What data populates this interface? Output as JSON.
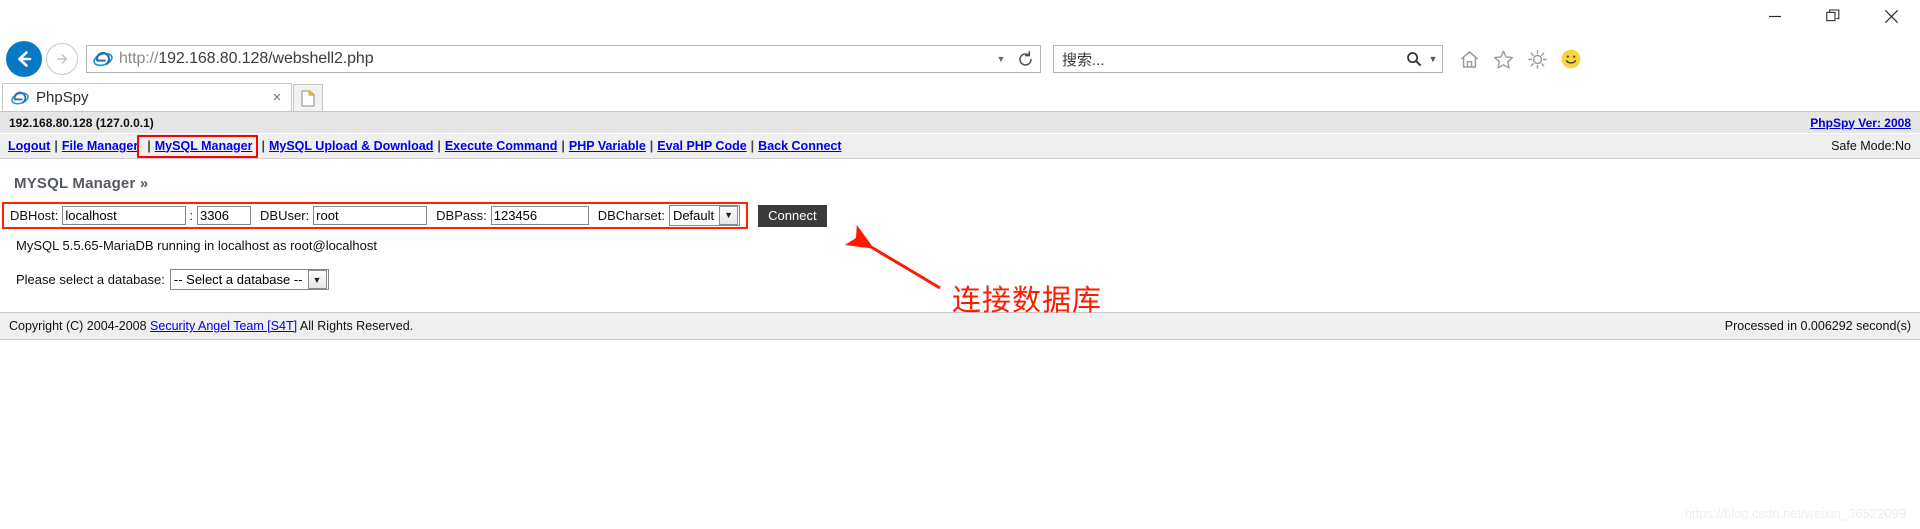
{
  "browser": {
    "window_controls": {
      "minimize": "minimize-icon",
      "restore": "restore-icon",
      "close": "close-icon"
    },
    "back_icon": "back-arrow-icon",
    "forward_icon": "forward-arrow-icon",
    "url_scheme": "http://",
    "url_rest": "192.168.80.128/webshell2.php",
    "url_full": "http://192.168.80.128/webshell2.php",
    "refresh_icon": "refresh-icon",
    "address_dropdown_icon": "chevron-down-icon",
    "search_placeholder": "搜索...",
    "search_icon": "search-magnifier-icon",
    "search_dropdown_icon": "chevron-down-icon",
    "toolbar_icons": [
      "home-icon",
      "favorites-star-icon",
      "gear-icon",
      "smiley-icon"
    ],
    "tab": {
      "title": "PhpSpy",
      "favicon": "ie-favicon-icon",
      "close_label": "×"
    },
    "new_tab_icon": "new-tab-icon"
  },
  "page": {
    "topbar": {
      "host": "192.168.80.128 (127.0.0.1)",
      "version_link": "PhpSpy Ver: 2008"
    },
    "nav": {
      "items": [
        {
          "label": "Logout",
          "highlighted": false
        },
        {
          "label": "File Manager",
          "highlighted": false
        },
        {
          "label": "MySQL Manager",
          "highlighted": true
        },
        {
          "label": "MySQL Upload & Download",
          "highlighted": false
        },
        {
          "label": "Execute Command",
          "highlighted": false
        },
        {
          "label": "PHP Variable",
          "highlighted": false
        },
        {
          "label": "Eval PHP Code",
          "highlighted": false
        },
        {
          "label": "Back Connect",
          "highlighted": false
        }
      ],
      "separator": "|",
      "safe_mode": "Safe Mode:No"
    },
    "section_title": "MYSQL Manager »",
    "form": {
      "dbhost_label": "DBHost:",
      "dbhost_value": "localhost",
      "port_separator": ":",
      "dbport_value": "3306",
      "dbuser_label": "DBUser:",
      "dbuser_value": "root",
      "dbpass_label": "DBPass:",
      "dbpass_value": "123456",
      "dbcharset_label": "DBCharset:",
      "dbcharset_value": "Default",
      "connect_label": "Connect"
    },
    "status_line": "MySQL 5.5.65-MariaDB running in localhost as root@localhost",
    "db_select": {
      "label": "Please select a database:",
      "value": "-- Select a database --"
    },
    "footer": {
      "copyright_prefix": "Copyright (C) 2004-2008 ",
      "team_link": "Security Angel Team [S4T]",
      "copyright_suffix": " All Rights Reserved.",
      "processed": "Processed in 0.006292 second(s)"
    }
  },
  "annotation": {
    "text": "连接数据库",
    "arrow_color": "#ff1a00",
    "highlight_color": "#ff2200"
  },
  "watermark": "https://blog.csdn.net/weixin_36522099"
}
